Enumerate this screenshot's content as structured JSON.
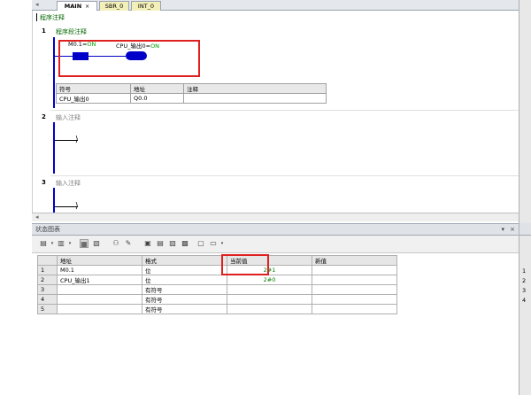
{
  "tabs": [
    {
      "label": "MAIN",
      "close": "×",
      "active": true
    },
    {
      "label": "SBR_0",
      "active": false
    },
    {
      "label": "INT_0",
      "active": false
    }
  ],
  "program_comment": "程序注释",
  "networks": [
    {
      "number": "1",
      "title": "程序段注释",
      "contact": {
        "name": "M0.1",
        "state": "ON"
      },
      "coil": {
        "name": "CPU_输出0",
        "state": "ON"
      },
      "symbol_table": {
        "headers": [
          "符号",
          "地址",
          "注释"
        ],
        "rows": [
          [
            "CPU_输出0",
            "Q0.0",
            ""
          ]
        ]
      }
    },
    {
      "number": "2",
      "title": "输入注释"
    },
    {
      "number": "3",
      "title": "输入注释"
    }
  ],
  "status_chart": {
    "title": "状态图表",
    "columns": [
      "地址",
      "格式",
      "当前值",
      "新值"
    ],
    "rows": [
      {
        "n": "1",
        "address": "M0.1",
        "format": "位",
        "current": "2#1",
        "new": ""
      },
      {
        "n": "2",
        "address": "CPU_输出1",
        "format": "位",
        "current": "2#0",
        "new": ""
      },
      {
        "n": "3",
        "address": "",
        "format": "有符号",
        "current": "",
        "new": ""
      },
      {
        "n": "4",
        "address": "",
        "format": "有符号",
        "current": "",
        "new": ""
      },
      {
        "n": "5",
        "address": "",
        "format": "有符号",
        "current": "",
        "new": ""
      }
    ]
  },
  "right_panel_numbers": [
    "1",
    "2",
    "3",
    "4"
  ],
  "colors": {
    "rung": "#0000c8",
    "highlight": "#e02020",
    "on_state": "#00a000"
  }
}
